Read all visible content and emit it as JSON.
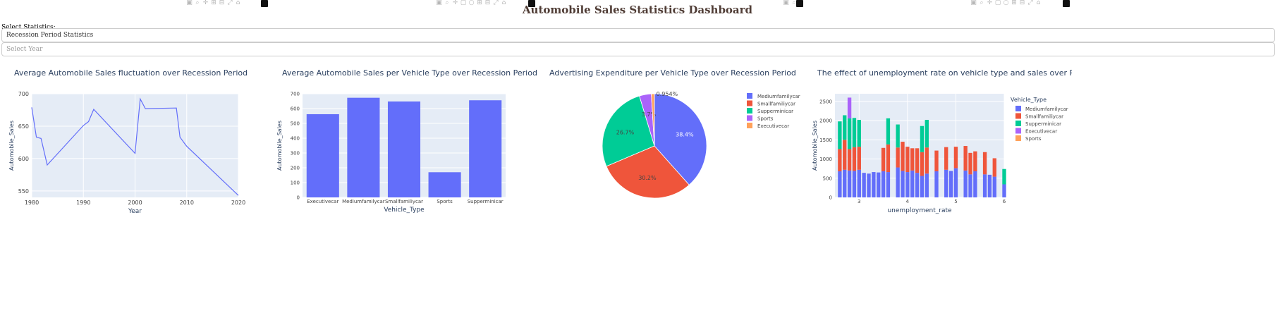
{
  "header": {
    "title": "Automobile Sales Statistics Dashboard"
  },
  "controls": {
    "select_label": "Select Statistics:",
    "statistics_value": "Recession Period Statistics",
    "year_placeholder": "Select Year"
  },
  "chart_data": [
    {
      "type": "line",
      "title": "Average Automobile Sales fluctuation over Recession Period",
      "xlabel": "Year",
      "ylabel": "Automobile_Sales",
      "xlim": [
        1980,
        2020
      ],
      "ylim": [
        540,
        700
      ],
      "xticks": [
        "1980",
        "1990",
        "2000",
        "2010",
        "2020"
      ],
      "yticks": [
        "550",
        "600",
        "650",
        "700"
      ],
      "color": "#636efa",
      "x": [
        1980,
        1980.9,
        1981.8,
        1983,
        1990,
        1991,
        1992,
        2000,
        2001,
        2002,
        2008,
        2008.7,
        2009.7,
        2010,
        2020
      ],
      "y": [
        679,
        633,
        631,
        590,
        651,
        657,
        676,
        608,
        692,
        677,
        678,
        633,
        622,
        619,
        543
      ]
    },
    {
      "type": "bar",
      "title": "Average Automobile Sales per Vehicle Type over Recession Period",
      "xlabel": "Vehicle_Type",
      "ylabel": "Automobile_Sales",
      "ylim": [
        0,
        700
      ],
      "yticks": [
        "0",
        "100",
        "200",
        "300",
        "400",
        "500",
        "600",
        "700"
      ],
      "color": "#636efa",
      "categories": [
        "Executivecar",
        "Mediumfamilycar",
        "Smallfamiliycar",
        "Sports",
        "Supperminicar"
      ],
      "values": [
        562,
        673,
        648,
        170,
        656
      ]
    },
    {
      "type": "pie",
      "title": "Advertising Expenditure per Vehicle Type over Recession Period",
      "labels": [
        "Mediumfamilycar",
        "Smallfamiliycar",
        "Supperminicar",
        "Sports",
        "Executivecar"
      ],
      "values": [
        38.4,
        30.2,
        26.7,
        3.7,
        0.954
      ],
      "text_labels": [
        "38.4%",
        "30.2%",
        "26.7%",
        "3.7%",
        "0.954%"
      ],
      "colors": [
        "#636efa",
        "#ef553b",
        "#00cc96",
        "#ab63fa",
        "#ffa15a"
      ],
      "legend": "right"
    },
    {
      "type": "bar",
      "stacked": true,
      "title": "The effect of unemployment rate on vehicle type and sales over Recession Period",
      "xlabel": "unemployment_rate",
      "ylabel": "Automobile_Sales",
      "legend_title": "Vehicle_Type",
      "xlim": [
        2.5,
        6
      ],
      "ylim": [
        0,
        2700
      ],
      "xticks": [
        "3",
        "4",
        "5",
        "6"
      ],
      "yticks": [
        "0",
        "500",
        "1000",
        "1500",
        "2000",
        "2500"
      ],
      "bar_width": 0.078,
      "x": [
        2.6,
        2.7,
        2.8,
        2.9,
        3.0,
        3.1,
        3.2,
        3.3,
        3.4,
        3.5,
        3.6,
        3.7,
        3.8,
        3.9,
        4.0,
        4.1,
        4.2,
        4.3,
        4.4,
        4.5,
        4.6,
        4.7,
        4.8,
        4.9,
        5.0,
        5.1,
        5.2,
        5.3,
        5.4,
        5.5,
        5.6,
        5.7,
        5.8,
        5.9,
        6.0
      ],
      "series": [
        {
          "name": "Mediumfamilycar",
          "color": "#636efa",
          "values": [
            680,
            720,
            700,
            690,
            720,
            640,
            620,
            660,
            650,
            680,
            660,
            0,
            780,
            690,
            660,
            700,
            640,
            560,
            620,
            0,
            680,
            0,
            720,
            690,
            760,
            0,
            700,
            600,
            680,
            0,
            600,
            590,
            540,
            0,
            340
          ]
        },
        {
          "name": "Smallfamiliycar",
          "color": "#ef553b",
          "values": [
            580,
            780,
            560,
            620,
            600,
            0,
            0,
            0,
            0,
            610,
            720,
            0,
            520,
            760,
            660,
            580,
            640,
            620,
            680,
            0,
            540,
            0,
            590,
            0,
            560,
            0,
            640,
            560,
            520,
            0,
            580,
            0,
            480,
            0,
            0
          ]
        },
        {
          "name": "Supperminicar",
          "color": "#00cc96",
          "values": [
            720,
            640,
            800,
            760,
            700,
            0,
            0,
            0,
            0,
            0,
            680,
            0,
            600,
            0,
            0,
            0,
            0,
            680,
            720,
            0,
            0,
            0,
            0,
            0,
            0,
            0,
            0,
            0,
            0,
            0,
            0,
            0,
            0,
            0,
            400
          ]
        },
        {
          "name": "Executivecar",
          "color": "#ab63fa",
          "values": [
            0,
            0,
            540,
            0,
            0,
            0,
            0,
            0,
            0,
            0,
            0,
            0,
            0,
            0,
            0,
            0,
            0,
            0,
            0,
            0,
            0,
            0,
            0,
            0,
            0,
            0,
            0,
            0,
            0,
            0,
            0,
            0,
            0,
            0,
            0
          ]
        },
        {
          "name": "Sports",
          "color": "#ffa15a",
          "values": [
            0,
            0,
            0,
            0,
            0,
            0,
            0,
            0,
            0,
            0,
            0,
            0,
            0,
            0,
            0,
            0,
            0,
            0,
            0,
            0,
            0,
            0,
            0,
            0,
            0,
            0,
            0,
            0,
            0,
            0,
            0,
            0,
            0,
            0,
            0
          ]
        }
      ]
    }
  ]
}
